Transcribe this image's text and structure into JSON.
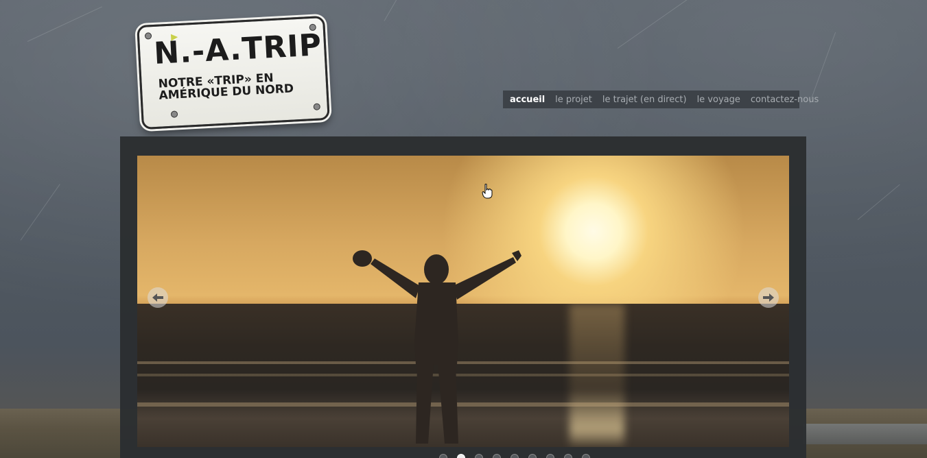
{
  "logo": {
    "title": "N.-A.TRIP",
    "subtitle_line1": "NOTRE «TRIP» EN",
    "subtitle_line2": "AMÉRIQUE DU NORD"
  },
  "nav": {
    "items": [
      {
        "label": "accueil",
        "active": true
      },
      {
        "label": "le projet",
        "active": false
      },
      {
        "label": "le trajet (en direct)",
        "active": false
      },
      {
        "label": "le voyage",
        "active": false
      },
      {
        "label": "contactez-nous",
        "active": false
      }
    ]
  },
  "slider": {
    "prev_icon": "arrow-left-icon",
    "next_icon": "arrow-right-icon",
    "slide_count": 9,
    "active_index": 1
  },
  "colors": {
    "nav_bg": "#3d4248",
    "nav_active": "#ffffff",
    "nav_inactive": "#a8adb2",
    "frame_bg": "#2b2e31"
  }
}
